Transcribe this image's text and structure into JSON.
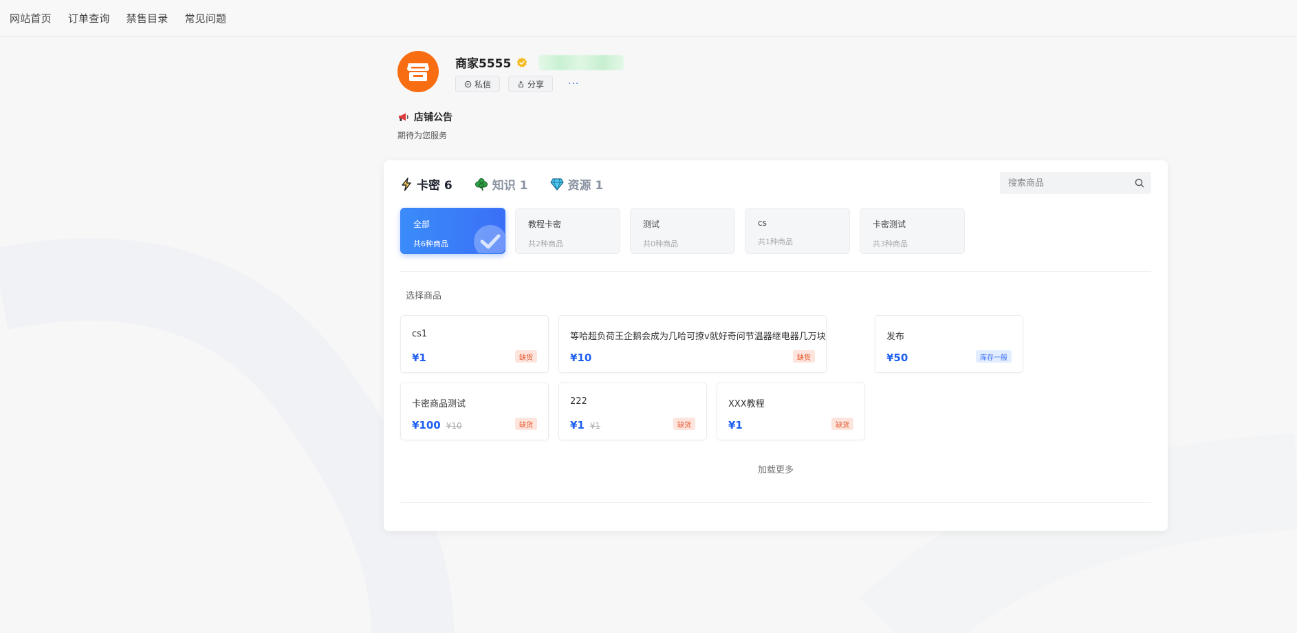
{
  "nav": {
    "items": [
      "网站首页",
      "订单查询",
      "禁售目录",
      "常见问题"
    ]
  },
  "shop": {
    "name": "商家5555",
    "actions": {
      "message": "私信",
      "share": "分享",
      "more": "···"
    },
    "notice_title": "店铺公告",
    "notice_text": "期待为您服务"
  },
  "tabs": [
    {
      "label": "卡密 6",
      "icon": "lightning-icon",
      "active": true
    },
    {
      "label": "知识 1",
      "icon": "clover-icon",
      "active": false
    },
    {
      "label": "资源 1",
      "icon": "diamond-icon",
      "active": false
    }
  ],
  "search": {
    "placeholder": "搜索商品"
  },
  "categories": [
    {
      "name": "全部",
      "count": "共6种商品",
      "active": true
    },
    {
      "name": "教程卡密",
      "count": "共2种商品",
      "active": false
    },
    {
      "name": "测试",
      "count": "共0种商品",
      "active": false
    },
    {
      "name": "cs",
      "count": "共1种商品",
      "active": false
    },
    {
      "name": "卡密测试",
      "count": "共3种商品",
      "active": false
    }
  ],
  "section_label": "选择商品",
  "products": [
    {
      "name": "cs1",
      "price": "¥1",
      "orig_price": "",
      "badge": "缺货",
      "badge_type": "out"
    },
    {
      "name": "等哈超负荷王企鹅会成为几哈可撩v就好奇问节温器继电器几万块",
      "price": "¥10",
      "orig_price": "",
      "badge": "缺货",
      "badge_type": "out"
    },
    {
      "name": "发布",
      "price": "¥50",
      "orig_price": "",
      "badge": "库存一般",
      "badge_type": "normal"
    },
    {
      "name": "卡密商品测试",
      "price": "¥100",
      "orig_price": "¥10",
      "badge": "缺货",
      "badge_type": "out"
    },
    {
      "name": "222",
      "price": "¥1",
      "orig_price": "¥1",
      "badge": "缺货",
      "badge_type": "out"
    },
    {
      "name": "XXX教程",
      "price": "¥1",
      "orig_price": "",
      "badge": "缺货",
      "badge_type": "out"
    }
  ],
  "load_more": "加载更多",
  "colors": {
    "accent": "#3a7ff8",
    "price": "#1e5ff0",
    "logo": "#f86d12",
    "out_of_stock": "#e4572e"
  }
}
